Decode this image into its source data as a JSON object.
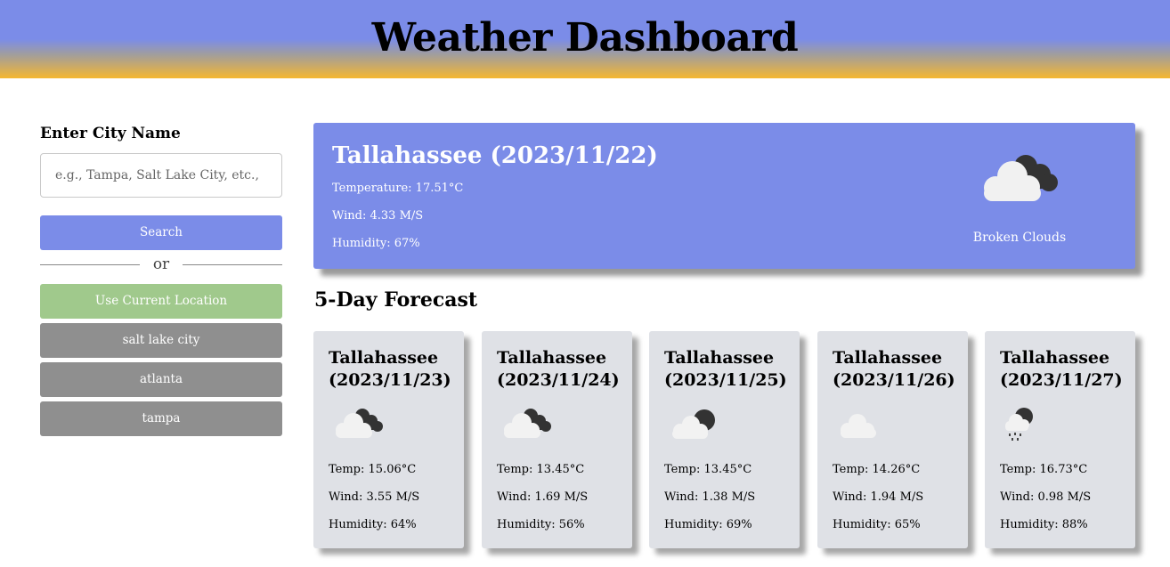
{
  "header": {
    "title": "Weather Dashboard"
  },
  "sidebar": {
    "label": "Enter City Name",
    "input_placeholder": "e.g., Tampa, Salt Lake City, etc.,",
    "input_value": "",
    "search_label": "Search",
    "or_label": "or",
    "location_label": "Use Current Location",
    "history": [
      "salt lake city",
      "atlanta",
      "tampa"
    ]
  },
  "current": {
    "title": "Tallahassee (2023/11/22)",
    "temperature": "Temperature: 17.51°C",
    "wind": "Wind: 4.33 M/S",
    "humidity": "Humidity: 67%",
    "description": "Broken Clouds",
    "icon": "broken-clouds-icon"
  },
  "forecast": {
    "heading": "5-Day Forecast",
    "days": [
      {
        "title": "Tallahassee (2023/11/23)",
        "icon": "broken-clouds-icon",
        "temp": "Temp: 15.06°C",
        "wind": "Wind: 3.55 M/S",
        "humidity": "Humidity: 64%"
      },
      {
        "title": "Tallahassee (2023/11/24)",
        "icon": "broken-clouds-icon",
        "temp": "Temp: 13.45°C",
        "wind": "Wind: 1.69 M/S",
        "humidity": "Humidity: 56%"
      },
      {
        "title": "Tallahassee (2023/11/25)",
        "icon": "overcast-clouds-icon",
        "temp": "Temp: 13.45°C",
        "wind": "Wind: 1.38 M/S",
        "humidity": "Humidity: 69%"
      },
      {
        "title": "Tallahassee (2023/11/26)",
        "icon": "scattered-clouds-icon",
        "temp": "Temp: 14.26°C",
        "wind": "Wind: 1.94 M/S",
        "humidity": "Humidity: 65%"
      },
      {
        "title": "Tallahassee (2023/11/27)",
        "icon": "rain-icon",
        "temp": "Temp: 16.73°C",
        "wind": "Wind: 0.98 M/S",
        "humidity": "Humidity: 88%"
      }
    ]
  },
  "colors": {
    "accent": "#7b8ce8",
    "location_button": "#a0c98c",
    "history_button": "#8f8f8f",
    "card_bg": "#dfe1e6",
    "header_bottom": "#f5b731"
  }
}
